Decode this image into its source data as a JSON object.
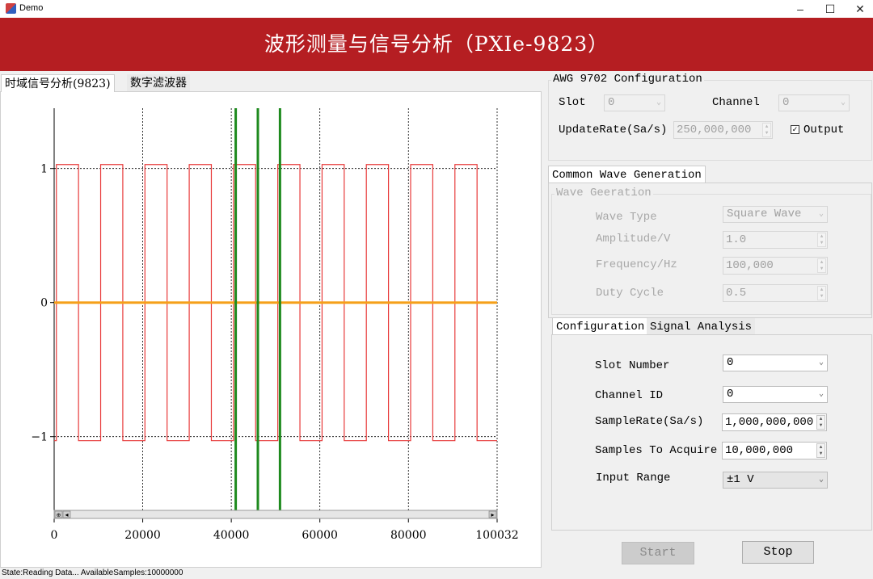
{
  "window": {
    "title": "Demo",
    "minimize": "–",
    "maximize": "☐",
    "close": "✕"
  },
  "banner": {
    "title": "波形测量与信号分析（PXIe-9823）"
  },
  "left_tabs": [
    {
      "label": "时域信号分析(9823)"
    },
    {
      "label": "数字滤波器"
    }
  ],
  "chart_data": {
    "type": "line",
    "xlim": [
      0,
      100032
    ],
    "ylim": [
      -1.55,
      1.45
    ],
    "x_ticks": [
      0,
      20000,
      40000,
      60000,
      80000,
      100032
    ],
    "x_tick_labels": [
      "0",
      "20000",
      "40000",
      "60000",
      "80000",
      "100032"
    ],
    "y_ticks": [
      1,
      0,
      -1
    ],
    "y_tick_labels": [
      "1",
      "0",
      "−1"
    ],
    "grid": "dotted vertical and horizontal at ticks",
    "cursors_x": [
      41000,
      46000,
      51000
    ],
    "series": [
      {
        "kind": "square",
        "color": "#e83a3a",
        "amplitude": 1.03,
        "period": 10000,
        "start_high": 500,
        "duty": 0.5
      },
      {
        "kind": "flat",
        "color": "#f5a01a",
        "value": 0
      }
    ],
    "colors": {
      "wave": "#e83a3a",
      "baseline": "#f5a01a",
      "cursor": "#1e8a1e",
      "grid": "#000000"
    }
  },
  "scrollbar": {
    "left_btn1": "⊕",
    "left_btn2": "◂",
    "right_btn": "▸"
  },
  "statusbar": {
    "text": "State:Reading Data...  AvailableSamples:10000000"
  },
  "awg": {
    "title": "AWG 9702 Configuration",
    "slot_label": "Slot",
    "slot_value": "0",
    "channel_label": "Channel",
    "channel_value": "0",
    "update_rate_label": "UpdateRate(Sa/s)",
    "update_rate_value": "250,000,000",
    "output_label": "Output",
    "output_check": "✓"
  },
  "wavegen": {
    "tab_label": "Common Wave Generation",
    "group_title": "Wave Geeration",
    "wave_type_label": "Wave Type",
    "wave_type_value": "Square Wave",
    "amplitude_label": "Amplitude/V",
    "amplitude_value": "1.0",
    "frequency_label": "Frequency/Hz",
    "frequency_value": "100,000",
    "duty_label": "Duty Cycle",
    "duty_value": "0.5"
  },
  "config": {
    "tabs": [
      {
        "label": "Configuration"
      },
      {
        "label": "Signal Analysis"
      }
    ],
    "slot_label": "Slot Number",
    "slot_value": "0",
    "channel_label": "Channel ID",
    "channel_value": "0",
    "sample_rate_label": "SampleRate(Sa/s)",
    "sample_rate_value": "1,000,000,000",
    "samples_label": "Samples To Acquire",
    "samples_value": "10,000,000",
    "range_label": "Input Range",
    "range_value": "±1 V"
  },
  "buttons": {
    "start": "Start",
    "stop": "Stop"
  }
}
